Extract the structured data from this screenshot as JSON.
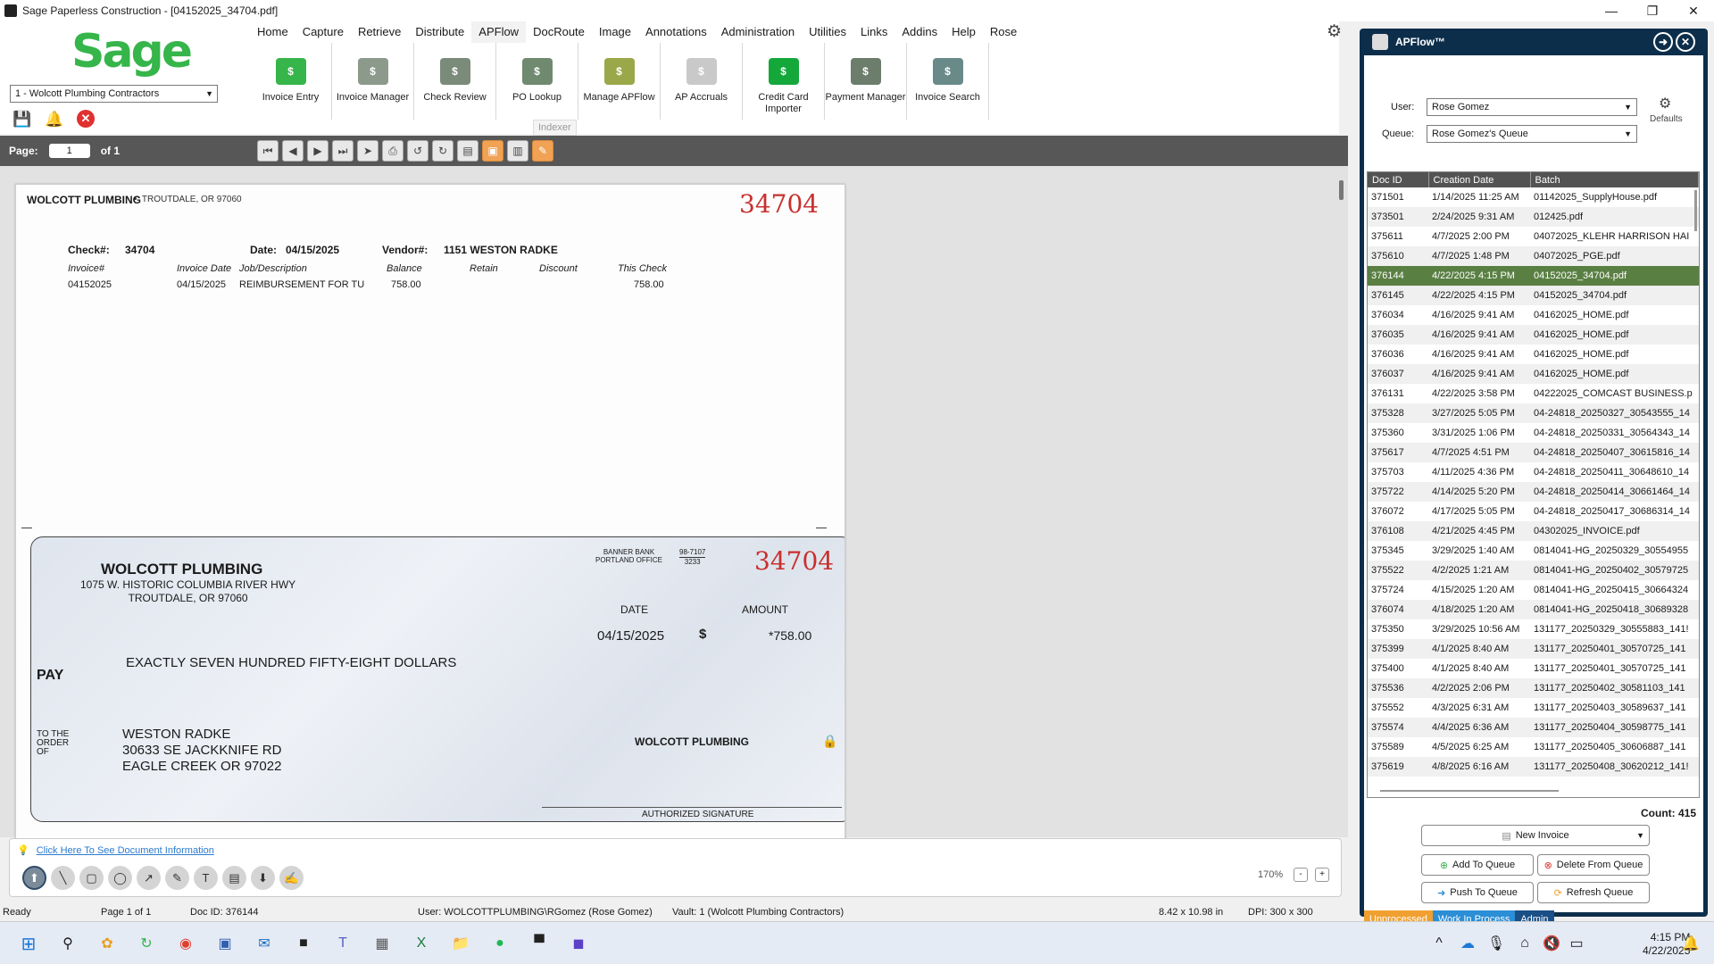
{
  "window": {
    "title": "Sage Paperless Construction - [04152025_34704.pdf]",
    "min": "—",
    "max": "❐",
    "close": "✕"
  },
  "brand": "Sage",
  "vault_select": "1 - Wolcott Plumbing Contractors",
  "menu": [
    "Home",
    "Capture",
    "Retrieve",
    "Distribute",
    "APFlow",
    "DocRoute",
    "Image",
    "Annotations",
    "Administration",
    "Utilities",
    "Links",
    "Addins",
    "Help",
    "Rose"
  ],
  "ribbon": [
    {
      "label": "Invoice Entry",
      "color": "#36b54a",
      "icon": "invoice-entry-icon"
    },
    {
      "label": "Invoice Manager",
      "color": "#8c9a8c",
      "icon": "invoice-manager-icon"
    },
    {
      "label": "Check Review",
      "color": "#7a8b7a",
      "icon": "check-review-icon"
    },
    {
      "label": "PO Lookup",
      "color": "#6f8a6f",
      "icon": "po-lookup-icon"
    },
    {
      "label": "Manage APFlow",
      "color": "#9aa84a",
      "icon": "manage-apflow-icon"
    },
    {
      "label": "AP Accruals",
      "color": "#c9c9c9",
      "icon": "ap-accruals-icon"
    },
    {
      "label": "Credit Card Importer",
      "color": "#14a83b",
      "icon": "credit-card-importer-icon"
    },
    {
      "label": "Payment Manager",
      "color": "#6c7d6c",
      "icon": "payment-manager-icon"
    },
    {
      "label": "Invoice Search",
      "color": "#6a8a8a",
      "icon": "invoice-search-icon"
    }
  ],
  "indexer_tooltip": "Indexer",
  "pager": {
    "label": "Page:",
    "current": "1",
    "of": "of 1"
  },
  "stub": {
    "company": "WOLCOTT PLUMBING",
    "location": "TROUTDALE, OR 97060",
    "check_number": "34704",
    "check_label": "Check#:",
    "check_value": "34704",
    "date_label": "Date:",
    "date_value": "04/15/2025",
    "vendor_label": "Vendor#:",
    "vendor_value": "1151 WESTON RADKE",
    "cols": [
      "Invoice#",
      "Invoice Date",
      "Job/Description",
      "Balance",
      "Retain",
      "Discount",
      "This Check"
    ],
    "row": [
      "04152025",
      "04/15/2025",
      "REIMBURSEMENT FOR TU",
      "758.00",
      "",
      "",
      "758.00"
    ]
  },
  "check": {
    "company": "WOLCOTT PLUMBING",
    "addr1": "1075 W. HISTORIC COLUMBIA RIVER HWY",
    "addr2": "TROUTDALE, OR 97060",
    "bank1": "BANNER BANK",
    "bank2": "PORTLAND OFFICE",
    "route1": "98-7107",
    "route2": "3233",
    "number": "34704",
    "date_label": "DATE",
    "amount_label": "AMOUNT",
    "date": "04/15/2025",
    "dollar": "$",
    "amount": "*758.00",
    "words": "EXACTLY SEVEN HUNDRED FIFTY-EIGHT  DOLLARS",
    "pay": "PAY",
    "to_order": "TO THE\nORDER\nOF",
    "payee1": "WESTON RADKE",
    "payee2": "30633 SE JACKKNIFE RD",
    "payee3": "EAGLE CREEK OR 97022",
    "signer": "WOLCOTT PLUMBING",
    "sig_label": "AUTHORIZED SIGNATURE"
  },
  "annotations": {
    "info_link": "Click Here To See Document Information",
    "zoom": "170%"
  },
  "status": {
    "ready": "Ready",
    "page": "Page 1 of 1",
    "docid": "Doc ID: 376144",
    "user": "User: WOLCOTTPLUMBING\\RGomez (Rose Gomez)",
    "vault": "Vault: 1 (Wolcott Plumbing Contractors)",
    "size": "8.42 x 10.98 in",
    "dpi": "DPI: 300 x 300"
  },
  "panel": {
    "title": "APFlow™",
    "user_label": "User:",
    "user_value": "Rose Gomez",
    "queue_label": "Queue:",
    "queue_value": "Rose Gomez's Queue",
    "defaults": "Defaults",
    "cols": [
      "Doc ID",
      "Creation Date",
      "Batch"
    ],
    "rows": [
      [
        "371501",
        "1/14/2025 11:25 AM",
        "01142025_SupplyHouse.pdf"
      ],
      [
        "373501",
        "2/24/2025 9:31 AM",
        "012425.pdf"
      ],
      [
        "375611",
        "4/7/2025 2:00 PM",
        "04072025_KLEHR HARRISON HAI"
      ],
      [
        "375610",
        "4/7/2025 1:48 PM",
        "04072025_PGE.pdf"
      ],
      [
        "376144",
        "4/22/2025 4:15 PM",
        "04152025_34704.pdf"
      ],
      [
        "376145",
        "4/22/2025 4:15 PM",
        "04152025_34704.pdf"
      ],
      [
        "376034",
        "4/16/2025 9:41 AM",
        "04162025_HOME.pdf"
      ],
      [
        "376035",
        "4/16/2025 9:41 AM",
        "04162025_HOME.pdf"
      ],
      [
        "376036",
        "4/16/2025 9:41 AM",
        "04162025_HOME.pdf"
      ],
      [
        "376037",
        "4/16/2025 9:41 AM",
        "04162025_HOME.pdf"
      ],
      [
        "376131",
        "4/22/2025 3:58 PM",
        "04222025_COMCAST BUSINESS.p"
      ],
      [
        "375328",
        "3/27/2025 5:05 PM",
        "04-24818_20250327_30543555_14"
      ],
      [
        "375360",
        "3/31/2025 1:06 PM",
        "04-24818_20250331_30564343_14"
      ],
      [
        "375617",
        "4/7/2025 4:51 PM",
        "04-24818_20250407_30615816_14"
      ],
      [
        "375703",
        "4/11/2025 4:36 PM",
        "04-24818_20250411_30648610_14"
      ],
      [
        "375722",
        "4/14/2025 5:20 PM",
        "04-24818_20250414_30661464_14"
      ],
      [
        "376072",
        "4/17/2025 5:05 PM",
        "04-24818_20250417_30686314_14"
      ],
      [
        "376108",
        "4/21/2025 4:45 PM",
        "04302025_INVOICE.pdf"
      ],
      [
        "375345",
        "3/29/2025 1:40 AM",
        "0814041-HG_20250329_30554955"
      ],
      [
        "375522",
        "4/2/2025 1:21 AM",
        "0814041-HG_20250402_30579725"
      ],
      [
        "375724",
        "4/15/2025 1:20 AM",
        "0814041-HG_20250415_30664324"
      ],
      [
        "376074",
        "4/18/2025 1:20 AM",
        "0814041-HG_20250418_30689328"
      ],
      [
        "375350",
        "3/29/2025 10:56 AM",
        "131177_20250329_30555883_141!"
      ],
      [
        "375399",
        "4/1/2025 8:40 AM",
        "131177_20250401_30570725_141"
      ],
      [
        "375400",
        "4/1/2025 8:40 AM",
        "131177_20250401_30570725_141"
      ],
      [
        "375536",
        "4/2/2025 2:06 PM",
        "131177_20250402_30581103_141"
      ],
      [
        "375552",
        "4/3/2025 6:31 AM",
        "131177_20250403_30589637_141"
      ],
      [
        "375574",
        "4/4/2025 6:36 AM",
        "131177_20250404_30598775_141"
      ],
      [
        "375589",
        "4/5/2025 6:25 AM",
        "131177_20250405_30606887_141"
      ],
      [
        "375619",
        "4/8/2025 6:16 AM",
        "131177_20250408_30620212_141!"
      ]
    ],
    "count": "Count: 415",
    "new_invoice": "New Invoice",
    "add_queue": "Add To Queue",
    "delete_queue": "Delete From Queue",
    "push_queue": "Push To Queue",
    "refresh_queue": "Refresh Queue",
    "tabs": [
      {
        "label": "Unprocessed",
        "color": "#f0a030"
      },
      {
        "label": "Work In Process",
        "color": "#2b8ed6"
      },
      {
        "label": "Admin",
        "color": "#1a4f87"
      }
    ]
  },
  "taskbar": {
    "time": "4:15 PM",
    "date": "4/22/2025"
  }
}
